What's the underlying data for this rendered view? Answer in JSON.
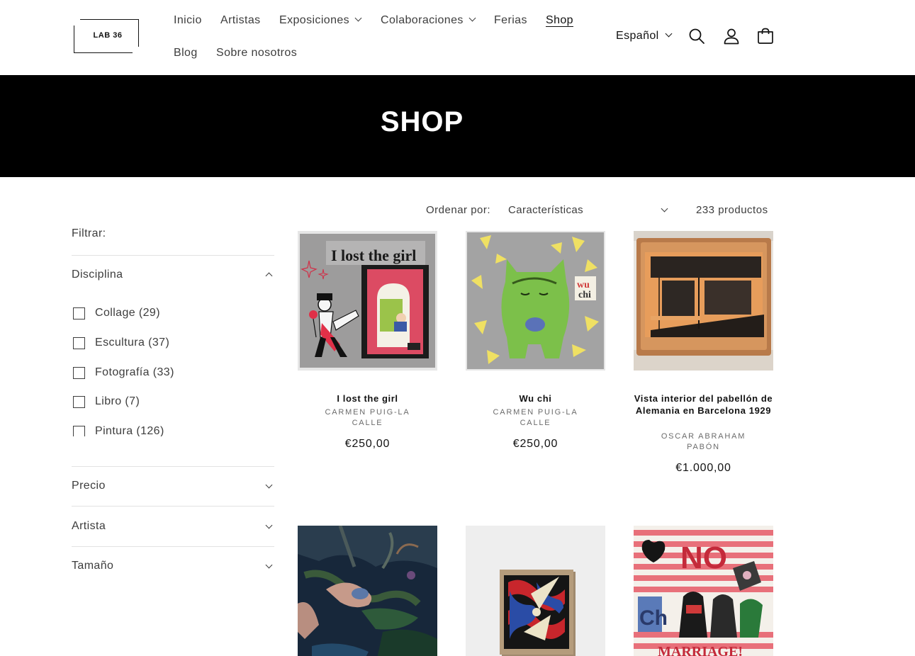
{
  "header": {
    "logo_text": "LAB 36",
    "nav": [
      {
        "label": "Inicio",
        "has_dropdown": false,
        "active": false
      },
      {
        "label": "Artistas",
        "has_dropdown": false,
        "active": false
      },
      {
        "label": "Exposiciones",
        "has_dropdown": true,
        "active": false
      },
      {
        "label": "Colaboraciones",
        "has_dropdown": true,
        "active": false
      },
      {
        "label": "Ferias",
        "has_dropdown": false,
        "active": false
      },
      {
        "label": "Shop",
        "has_dropdown": false,
        "active": true
      },
      {
        "label": "Blog",
        "has_dropdown": false,
        "active": false
      },
      {
        "label": "Sobre nosotros",
        "has_dropdown": false,
        "active": false
      }
    ],
    "language": "Español",
    "icons": [
      "search-icon",
      "account-icon",
      "cart-icon"
    ]
  },
  "banner": {
    "title": "SHOP"
  },
  "filters": {
    "heading": "Filtrar:",
    "facets": [
      {
        "title": "Disciplina",
        "expanded": true,
        "options": [
          {
            "label": "Collage (29)",
            "checked": false
          },
          {
            "label": "Escultura (37)",
            "checked": false
          },
          {
            "label": "Fotografía (33)",
            "checked": false
          },
          {
            "label": "Libro (7)",
            "checked": false
          },
          {
            "label": "Pintura (126)",
            "checked": false
          }
        ]
      },
      {
        "title": "Precio",
        "expanded": false
      },
      {
        "title": "Artista",
        "expanded": false
      },
      {
        "title": "Tamaño",
        "expanded": false
      }
    ]
  },
  "sort": {
    "label": "Ordenar por:",
    "selected": "Características",
    "product_count": "233 productos"
  },
  "products": [
    {
      "title": "I lost the girl",
      "vendor": "Carmen Puig-La Calle",
      "price": "€250,00",
      "image": "artwork-i-lost-the-girl"
    },
    {
      "title": "Wu chi",
      "vendor": "Carmen Puig-La Calle",
      "price": "€250,00",
      "image": "artwork-wu-chi"
    },
    {
      "title": "Vista interior del pabellón de Alemania en Barcelona 1929",
      "vendor": "Oscar Abraham Pabón",
      "price": "€1.000,00",
      "image": "artwork-pabellon"
    },
    {
      "title": "",
      "vendor": "",
      "price": "",
      "image": "artwork-forest-figures"
    },
    {
      "title": "",
      "vendor": "",
      "price": "",
      "image": "artwork-geometric-knot"
    },
    {
      "title": "",
      "vendor": "",
      "price": "",
      "image": "artwork-no-marriage"
    }
  ],
  "colors": {
    "banner_bg": "#000000",
    "text": "#121212",
    "muted": "#3d3d3d"
  }
}
